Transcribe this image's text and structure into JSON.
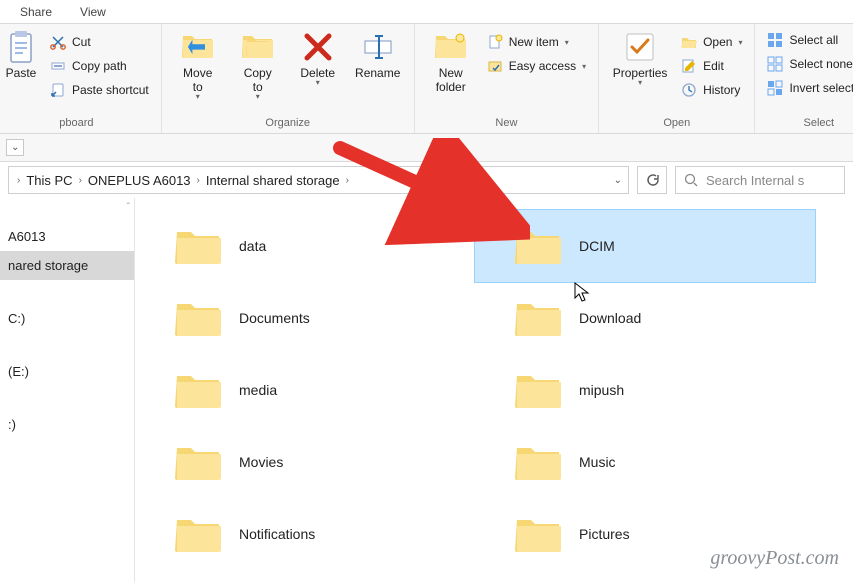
{
  "tabs": {
    "share": "Share",
    "view": "View"
  },
  "ribbon": {
    "clipboard": {
      "label": "pboard",
      "paste": "Paste",
      "cut": "Cut",
      "copy_path": "Copy path",
      "paste_shortcut": "Paste shortcut"
    },
    "organize": {
      "label": "Organize",
      "move_to": "Move\nto",
      "copy_to": "Copy\nto",
      "delete": "Delete",
      "rename": "Rename"
    },
    "new": {
      "label": "New",
      "new_folder": "New\nfolder",
      "new_item": "New item",
      "easy_access": "Easy access"
    },
    "open": {
      "label": "Open",
      "properties": "Properties",
      "open": "Open",
      "edit": "Edit",
      "history": "History"
    },
    "select": {
      "label": "Select",
      "select_all": "Select all",
      "select_none": "Select none",
      "invert": "Invert selection"
    }
  },
  "breadcrumb": {
    "this_pc": "This PC",
    "device": "ONEPLUS A6013",
    "storage": "Internal shared storage"
  },
  "search": {
    "placeholder": "Search Internal s"
  },
  "nav": {
    "device": "A6013",
    "storage": "nared storage",
    "drive_c": "C:)",
    "drive_e": "(E:)",
    "last": ":)"
  },
  "folders": [
    {
      "name": "data"
    },
    {
      "name": "DCIM",
      "selected": true
    },
    {
      "name": "Documents"
    },
    {
      "name": "Download"
    },
    {
      "name": "media"
    },
    {
      "name": "mipush"
    },
    {
      "name": "Movies"
    },
    {
      "name": "Music"
    },
    {
      "name": "Notifications"
    },
    {
      "name": "Pictures"
    }
  ],
  "watermark": "groovyPost.com"
}
